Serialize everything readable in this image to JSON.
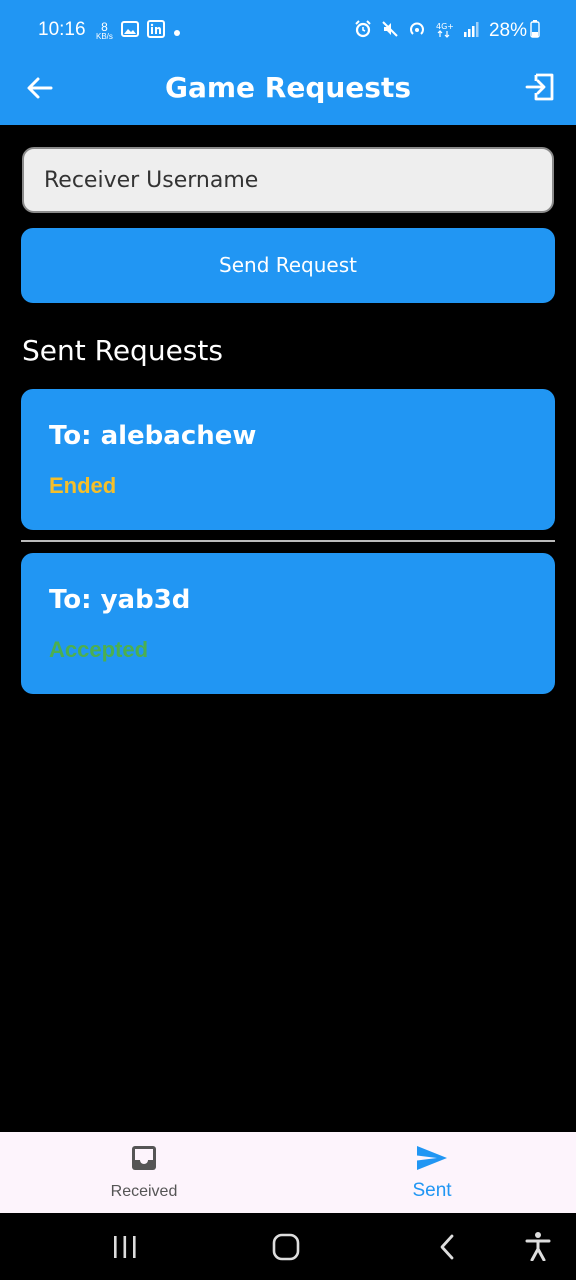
{
  "status_bar": {
    "time": "10:16",
    "net_speed_value": "8",
    "net_speed_unit": "KB/s",
    "battery": "28%",
    "icons_left": [
      "gallery-icon",
      "linkedin-icon",
      "dot-icon"
    ],
    "icons_right": [
      "alarm-icon",
      "mute-icon",
      "hotspot-icon",
      "4g-icon",
      "signal-icon",
      "battery-icon"
    ]
  },
  "app_bar": {
    "title": "Game Requests",
    "back_icon": "arrow-left-icon",
    "exit_icon": "exit-icon"
  },
  "form": {
    "receiver_placeholder": "Receiver Username",
    "receiver_value": "",
    "send_label": "Send Request"
  },
  "sent_section": {
    "title": "Sent Requests",
    "requests": [
      {
        "to": "To: alebachew",
        "status": "Ended",
        "status_color": "#F5BF2A"
      },
      {
        "to": "To: yab3d",
        "status": "Accepted",
        "status_color": "#4CAF50"
      }
    ]
  },
  "bottom_nav": {
    "items": [
      {
        "label": "Received",
        "icon": "inbox-icon",
        "active": false
      },
      {
        "label": "Sent",
        "icon": "send-icon",
        "active": true
      }
    ],
    "active_color": "#2196F3",
    "inactive_color": "#555555"
  },
  "system_nav": [
    "recents-button",
    "home-button",
    "back-button",
    "accessibility-button"
  ],
  "colors": {
    "primary": "#2196F3",
    "background": "#000000"
  }
}
